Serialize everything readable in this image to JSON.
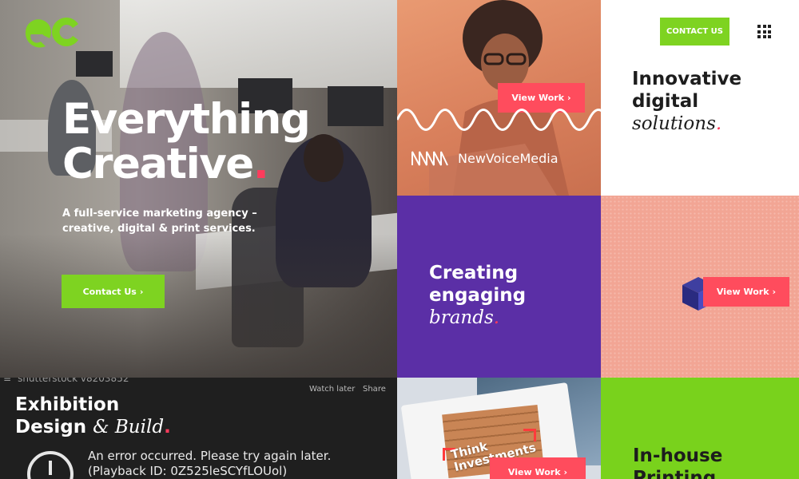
{
  "hero": {
    "logo_text": "ec",
    "title_line1": "Everything",
    "title_line2": "Creative",
    "title_dot": ".",
    "subtitle": "A full-service marketing agency – creative, digital & print services.",
    "cta_label": "Contact Us",
    "cta_chevron": "›"
  },
  "header": {
    "contact_label": "CONTACT US",
    "menu_icon": "grid-menu-icon"
  },
  "tiles": {
    "newvoice": {
      "button_label": "View Work",
      "brand_name": "NewVoiceMedia"
    },
    "innovative": {
      "line1": "Innovative",
      "line2": "digital",
      "line3": "solutions",
      "dot": "."
    },
    "engaging": {
      "line1": "Creating",
      "line2": "engaging",
      "line3": "brands",
      "dot": "."
    },
    "pink": {
      "button_label": "View Work"
    },
    "exhibition": {
      "video_title": "shutterstock v8203852",
      "watch_later": "Watch later",
      "share": "Share",
      "line1": "Exhibition",
      "line2": "Design",
      "line2_ital": "& Build",
      "dot": ".",
      "error_line1": "An error occurred. Please try again later.",
      "error_line2": "(Playback ID: 0Z525leSCYfLOUol)"
    },
    "magazine": {
      "cover_text_1": "Think",
      "cover_text_2": "Investments",
      "button_label": "View Work"
    },
    "printing": {
      "line1": "In-house",
      "line2": "Printing"
    }
  },
  "colors": {
    "accent_green": "#7ed321",
    "accent_red": "#ff4c5d",
    "accent_pink_dot": "#ff3b5c",
    "purple": "#5b2fa6",
    "pink": "#f2a594"
  }
}
